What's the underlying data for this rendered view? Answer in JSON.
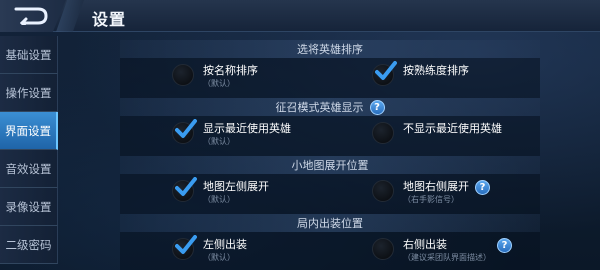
{
  "header": {
    "title": "设置"
  },
  "sidebar": {
    "items": [
      {
        "label": "基础设置",
        "active": false
      },
      {
        "label": "操作设置",
        "active": false
      },
      {
        "label": "界面设置",
        "active": true
      },
      {
        "label": "音效设置",
        "active": false
      },
      {
        "label": "录像设置",
        "active": false
      },
      {
        "label": "二级密码",
        "active": false
      }
    ]
  },
  "sections": [
    {
      "title": "选将英雄排序",
      "has_help": false,
      "left": {
        "label": "按名称排序",
        "sub": "（默认）",
        "checked": false,
        "has_help": false
      },
      "right": {
        "label": "按熟练度排序",
        "sub": "",
        "checked": true,
        "has_help": false
      }
    },
    {
      "title": "征召模式英雄显示",
      "has_help": true,
      "left": {
        "label": "显示最近使用英雄",
        "sub": "（默认）",
        "checked": true,
        "has_help": false
      },
      "right": {
        "label": "不显示最近使用英雄",
        "sub": "",
        "checked": false,
        "has_help": false
      }
    },
    {
      "title": "小地图展开位置",
      "has_help": false,
      "left": {
        "label": "地图左侧展开",
        "sub": "（默认）",
        "checked": true,
        "has_help": false
      },
      "right": {
        "label": "地图右侧展开",
        "sub": "（右手影信号）",
        "checked": false,
        "has_help": true
      }
    },
    {
      "title": "局内出装位置",
      "has_help": false,
      "left": {
        "label": "左侧出装",
        "sub": "（默认）",
        "checked": true,
        "has_help": false
      },
      "right": {
        "label": "右侧出装",
        "sub": "（建议采团队界面描述）",
        "checked": false,
        "has_help": true
      }
    }
  ],
  "colors": {
    "accent": "#2f7fc8",
    "check": "#3a9cf0",
    "text": "#ffffff"
  },
  "icons": {
    "back": "back-arrow-icon",
    "help": "help-icon",
    "check": "checkmark-icon",
    "radio": "radio-icon"
  },
  "help_glyph": "?"
}
